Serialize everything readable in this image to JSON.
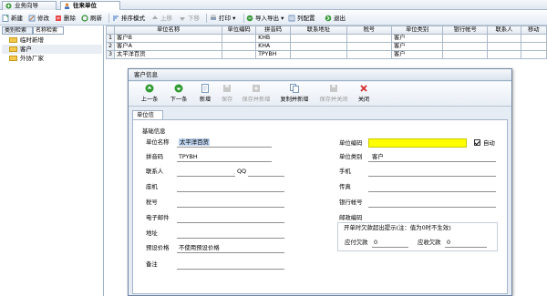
{
  "tabs": [
    "业务向导",
    "往来单位"
  ],
  "toolbar": {
    "new": "新建",
    "edit": "修改",
    "delete": "删除",
    "refresh": "刷新",
    "sort_mode": "排序模式",
    "move_up": "上移",
    "move_down": "下移",
    "print": "打印",
    "import_export": "导入导出",
    "col_config": "列配置",
    "exit": "退出"
  },
  "left_tabs": [
    "类别检索",
    "名称检索"
  ],
  "tree": [
    "临时新增",
    "客户",
    "外协厂家"
  ],
  "grid": {
    "columns": [
      "",
      "单位名称",
      "单位编码",
      "拼音码",
      "联系地址",
      "税号",
      "单位类别",
      "银行帐号",
      "联系人",
      "移动"
    ],
    "rows": [
      [
        "1",
        "客户B",
        "",
        "KHB",
        "",
        "",
        "客户",
        "",
        "",
        ""
      ],
      [
        "2",
        "客户A",
        "",
        "KHA",
        "",
        "",
        "客户",
        "",
        "",
        ""
      ],
      [
        "3",
        "太平洋百货",
        "",
        "TPYBH",
        "",
        "",
        "客户",
        "",
        "",
        ""
      ]
    ]
  },
  "dialog": {
    "title": "客户信息",
    "buttons": [
      "上一条",
      "下一条",
      "新增",
      "保存",
      "保存并新增",
      "复制并新增",
      "保存并关闭",
      "关闭"
    ],
    "tab": "单位信息",
    "section": "基础信息",
    "fields": {
      "name_label": "单位名称",
      "name_value": "太平洋百货",
      "code_label": "单位编码",
      "auto_label": "自动",
      "pinyin_label": "拼音码",
      "pinyin_value": "TPYBH",
      "category_label": "单位类别",
      "category_value": "客户",
      "contact_label": "联系人",
      "qq_label": "QQ",
      "mobile_label": "手机",
      "phone_label": "座机",
      "fax_label": "传真",
      "tax_label": "税号",
      "bank_label": "银行帐号",
      "email_label": "电子邮件",
      "postcode_label": "邮政编码",
      "address_label": "地址",
      "price_label": "预设价格",
      "price_value": "不使用预设价格",
      "remark_label": "备注",
      "warn_title": "开单时欠款超出提示(注：值为0时不生效)",
      "receivable_label": "应付欠款",
      "receivable_value": "0",
      "payable_label": "应收欠款",
      "payable_value": "0"
    }
  }
}
